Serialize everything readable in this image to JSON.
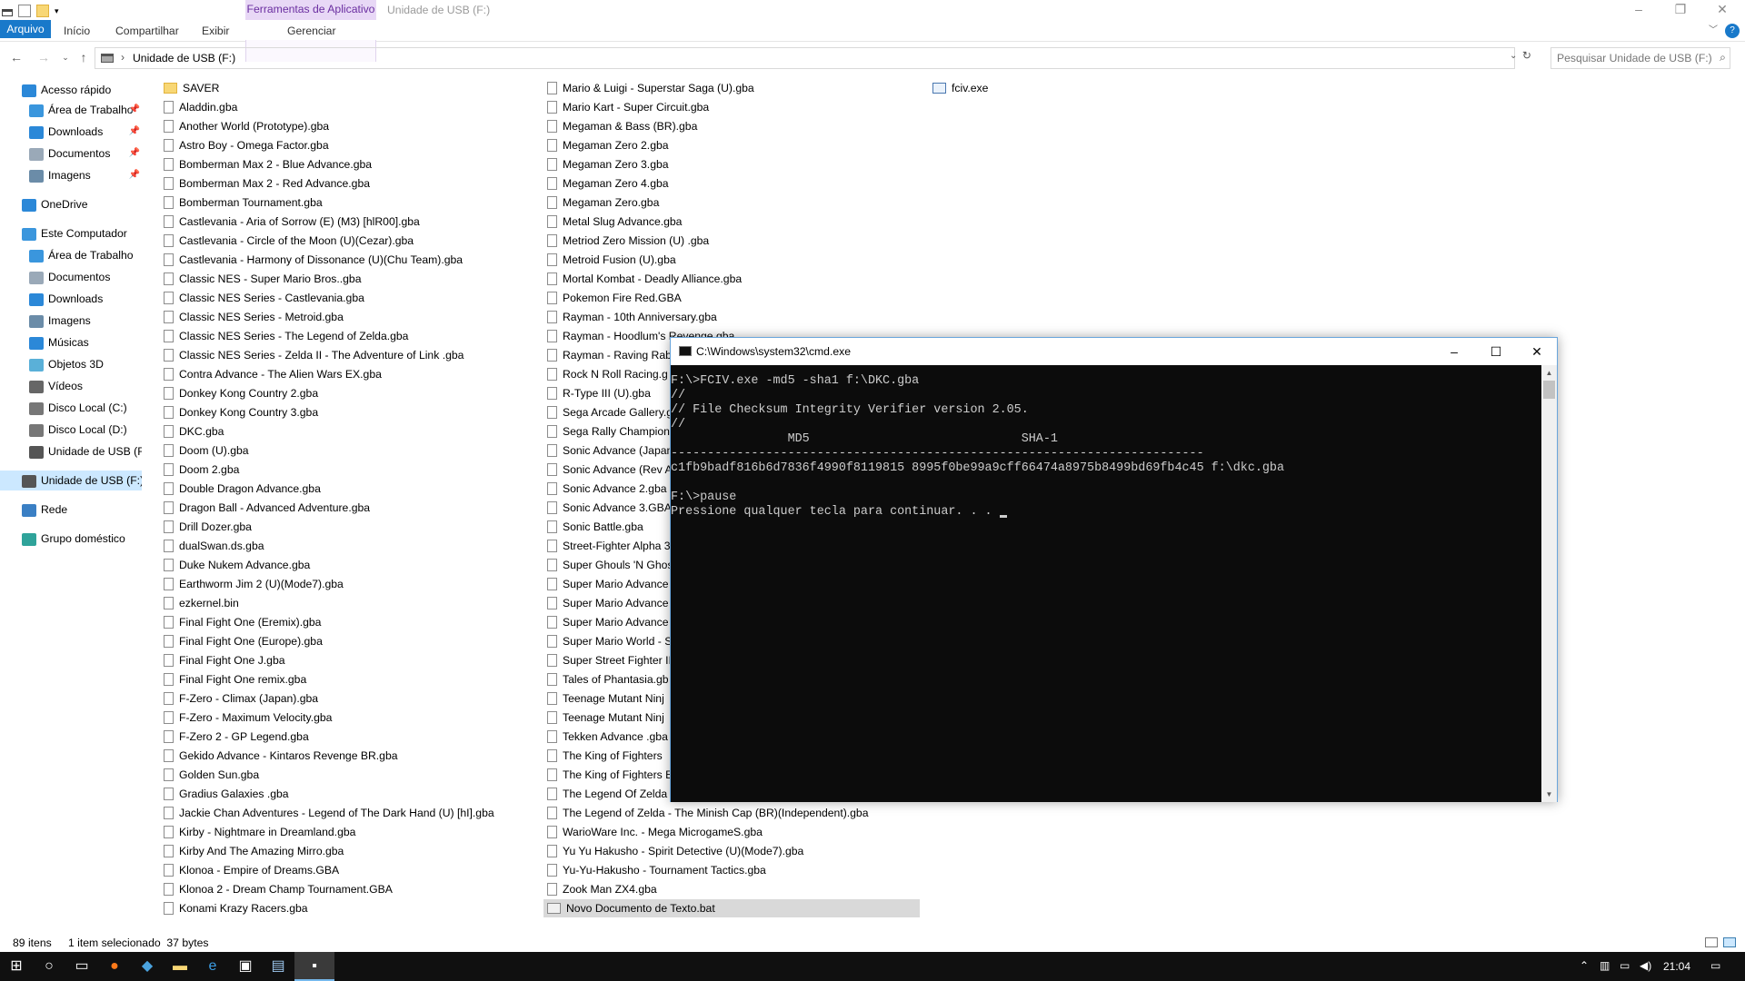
{
  "titlebar": {
    "context_tab": "Ferramentas de Aplicativo",
    "title": "Unidade de USB (F:)"
  },
  "ribbon": {
    "tabs": [
      "Arquivo",
      "Início",
      "Compartilhar",
      "Exibir"
    ],
    "context_tab": "Gerenciar"
  },
  "address": {
    "path": "Unidade de USB (F:)",
    "search_placeholder": "Pesquisar Unidade de USB (F:)"
  },
  "nav": {
    "items": [
      "Acesso rápido",
      "Área de Trabalho",
      "Downloads",
      "Documentos",
      "Imagens",
      "OneDrive",
      "Este Computador",
      "Área de Trabalho",
      "Documentos",
      "Downloads",
      "Imagens",
      "Músicas",
      "Objetos 3D",
      "Vídeos",
      "Disco Local (C:)",
      "Disco Local (D:)",
      "Unidade de USB (F:)",
      "Unidade de USB (F:)",
      "Rede",
      "Grupo doméstico"
    ]
  },
  "files": {
    "col1": [
      "SAVER",
      "Aladdin.gba",
      "Another World (Prototype).gba",
      "Astro Boy - Omega Factor.gba",
      "Bomberman Max 2 - Blue Advance.gba",
      "Bomberman Max 2 - Red Advance.gba",
      "Bomberman Tournament.gba",
      "Castlevania - Aria of Sorrow (E) (M3) [hlR00].gba",
      "Castlevania - Circle of the Moon (U)(Cezar).gba",
      "Castlevania - Harmony of Dissonance (U)(Chu Team).gba",
      "Classic NES - Super Mario Bros..gba",
      "Classic NES Series - Castlevania.gba",
      "Classic NES Series - Metroid.gba",
      "Classic NES Series - The Legend of Zelda.gba",
      "Classic NES Series - Zelda II - The Adventure of Link .gba",
      "Contra Advance - The Alien Wars EX.gba",
      "Donkey Kong Country 2.gba",
      "Donkey Kong Country 3.gba",
      "DKC.gba",
      "Doom (U).gba",
      "Doom 2.gba",
      "Double Dragon Advance.gba",
      "Dragon Ball - Advanced Adventure.gba",
      "Drill Dozer.gba",
      "dualSwan.ds.gba",
      "Duke Nukem Advance.gba",
      "Earthworm Jim 2 (U)(Mode7).gba",
      "ezkernel.bin",
      "Final Fight One (Eremix).gba",
      "Final Fight One (Europe).gba",
      "Final Fight One J.gba",
      "Final Fight One remix.gba",
      "F-Zero - Climax (Japan).gba",
      "F-Zero - Maximum Velocity.gba",
      "F-Zero 2 - GP Legend.gba",
      "Gekido Advance - Kintaros Revenge BR.gba",
      "Golden Sun.gba",
      "Gradius Galaxies .gba",
      "Jackie Chan Adventures - Legend of The Dark Hand (U) [hI].gba",
      "Kirby - Nightmare in Dreamland.gba",
      "Kirby And The Amazing Mirro.gba",
      "Klonoa - Empire of Dreams.GBA",
      "Klonoa 2 - Dream Champ Tournament.GBA",
      "Konami Krazy Racers.gba"
    ],
    "col2": [
      "Mario & Luigi - Superstar Saga (U).gba",
      "Mario Kart - Super Circuit.gba",
      "Megaman & Bass (BR).gba",
      "Megaman Zero 2.gba",
      "Megaman Zero 3.gba",
      "Megaman Zero 4.gba",
      "Megaman Zero.gba",
      "Metal Slug Advance.gba",
      "Metriod Zero Mission (U) .gba",
      "Metroid Fusion (U).gba",
      "Mortal Kombat - Deadly Alliance.gba",
      "Pokemon Fire Red.GBA",
      "Rayman - 10th Anniversary.gba",
      "Rayman - Hoodlum's Revenge.gba",
      "Rayman - Raving Rab",
      "Rock N Roll Racing.g",
      "R-Type III (U).gba",
      "Sega Arcade Gallery.g",
      "Sega Rally Champion",
      "Sonic Advance (Japan",
      "Sonic Advance (Rev A",
      "Sonic Advance 2.gba",
      "Sonic Advance 3.GBA",
      "Sonic Battle.gba",
      "Street-Fighter Alpha 3",
      "Super Ghouls 'N Ghos",
      "Super Mario Advance",
      "Super Mario Advance",
      "Super Mario Advance",
      "Super Mario World - S",
      "Super Street Fighter II",
      "Tales of Phantasia.gb",
      "Teenage Mutant Ninj",
      "Teenage Mutant Ninj",
      "Tekken Advance .gba",
      "The  King of Fighters",
      "The King of Fighters E",
      "The Legend Of Zelda",
      "The Legend of Zelda - The Minish Cap (BR)(Independent).gba",
      "WarioWare Inc. - Mega MicrogameS.gba",
      "Yu Yu Hakusho - Spirit Detective (U)(Mode7).gba",
      "Yu-Yu-Hakusho - Tournament Tactics.gba",
      "Zook Man ZX4.gba",
      "Novo Documento de Texto.bat"
    ],
    "col3": [
      "fciv.exe"
    ]
  },
  "status": {
    "count": "89 itens",
    "selection": "1 item selecionado  37 bytes"
  },
  "cmd": {
    "title": "C:\\Windows\\system32\\cmd.exe",
    "lines": [
      "F:\\>FCIV.exe -md5 -sha1 f:\\DKC.gba",
      "//",
      "// File Checksum Integrity Verifier version 2.05.",
      "//",
      "                MD5                             SHA-1",
      "-------------------------------------------------------------------------",
      "c1fb9badf816b6d7836f4990f8119815 8995f0be99a9cff66474a8975b8499bd69fb4c45 f:\\dkc.gba",
      "",
      "F:\\>pause",
      "Pressione qualquer tecla para continuar. . . "
    ]
  },
  "taskbar": {
    "time": "21:04"
  },
  "colors": {
    "accent": "#1979ca",
    "context": "#6a2ea0",
    "console_bg": "#0c0c0c",
    "console_fg": "#cccccc"
  }
}
